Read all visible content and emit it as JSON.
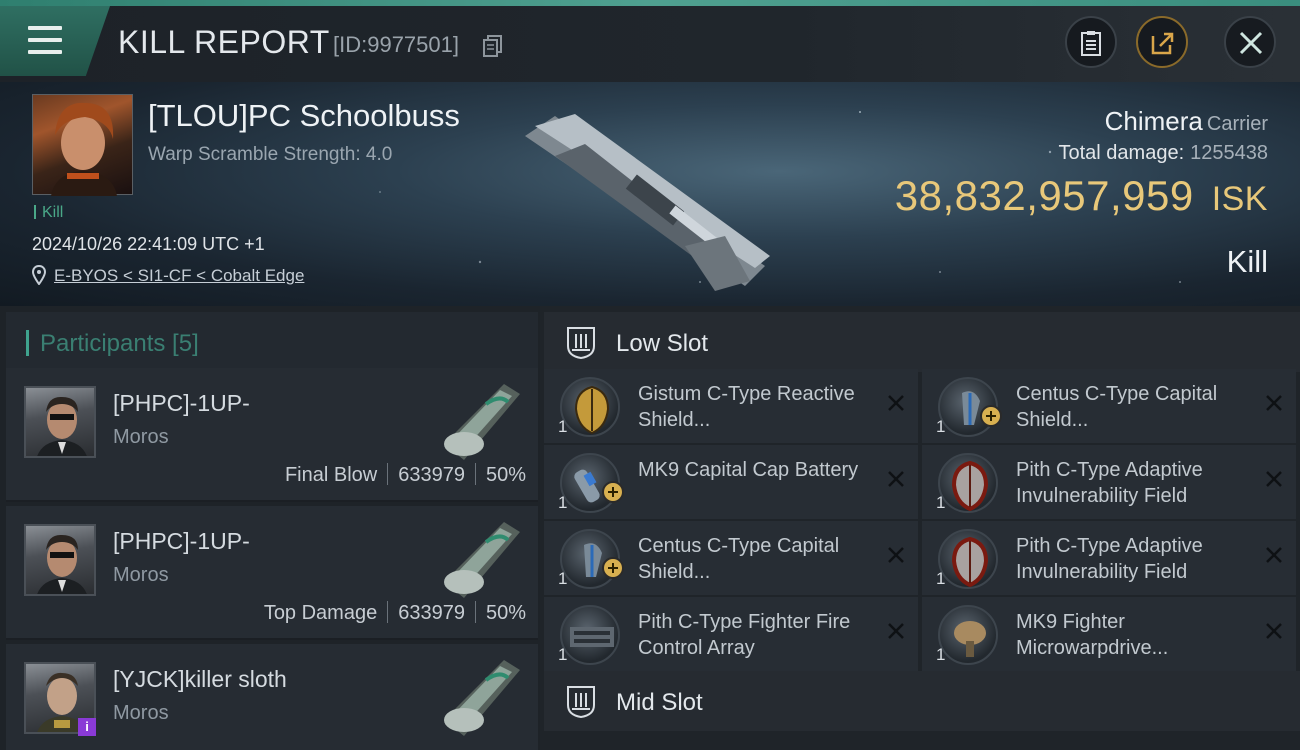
{
  "header": {
    "title": "KILL REPORT",
    "report_id": "[ID:9977501]"
  },
  "victim": {
    "name": "[TLOU]PC Schoolbuss",
    "warp_scramble": "Warp Scramble Strength: 4.0",
    "tag": "Kill",
    "datetime": "2024/10/26 22:41:09 UTC +1",
    "location": "E-BYOS < SI1-CF < Cobalt Edge",
    "ship_name": "Chimera",
    "ship_class": "Carrier",
    "total_damage_label": "Total damage:",
    "total_damage": "1255438",
    "isk_value": "38,832,957,959",
    "isk_unit": "ISK",
    "kill_type": "Kill"
  },
  "participants": {
    "title": "Participants [5]",
    "items": [
      {
        "name": "[PHPC]-1UP-",
        "ship": "Moros",
        "role": "Final Blow",
        "damage": "633979",
        "percent": "50%"
      },
      {
        "name": "[PHPC]-1UP-",
        "ship": "Moros",
        "role": "Top Damage",
        "damage": "633979",
        "percent": "50%"
      },
      {
        "name": "[YJCK]killer sloth",
        "ship": "Moros",
        "role": "",
        "damage": "",
        "percent": ""
      }
    ]
  },
  "slots": {
    "low": {
      "title": "Low Slot",
      "modules": [
        {
          "name": "Gistum C-Type Reactive Shield...",
          "qty": "1",
          "icon": "shield-hardener-gold-icon"
        },
        {
          "name": "Centus C-Type Capital Shield...",
          "qty": "1",
          "icon": "capital-shield-icon"
        },
        {
          "name": "MK9 Capital Cap Battery",
          "qty": "1",
          "icon": "cap-battery-icon"
        },
        {
          "name": "Pith C-Type Adaptive Invulnerability Field",
          "qty": "1",
          "icon": "invuln-field-icon"
        },
        {
          "name": "Centus C-Type Capital Shield...",
          "qty": "1",
          "icon": "capital-shield-icon"
        },
        {
          "name": "Pith C-Type Adaptive Invulnerability Field",
          "qty": "1",
          "icon": "invuln-field-icon"
        },
        {
          "name": "Pith C-Type Fighter Fire Control Array",
          "qty": "1",
          "icon": "fighter-fire-control-icon"
        },
        {
          "name": "MK9 Fighter Microwarpdrive...",
          "qty": "1",
          "icon": "fighter-mwd-icon"
        }
      ]
    },
    "mid": {
      "title": "Mid Slot"
    }
  },
  "colors": {
    "accent": "#3fa38e",
    "isk": "#e8c87a",
    "background": "#1b1f24"
  }
}
